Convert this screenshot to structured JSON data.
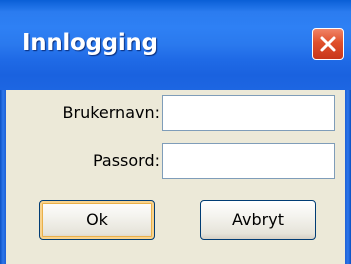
{
  "window": {
    "title": "Innlogging",
    "close_icon": "close-icon"
  },
  "form": {
    "username_label": "Brukernavn:",
    "username_value": "",
    "password_label": "Passord:",
    "password_value": ""
  },
  "buttons": {
    "ok_label": "Ok",
    "cancel_label": "Avbryt"
  },
  "colors": {
    "titlebar": "#2b7cf0",
    "close_button": "#e0502b",
    "client_background": "#ece9d8"
  }
}
